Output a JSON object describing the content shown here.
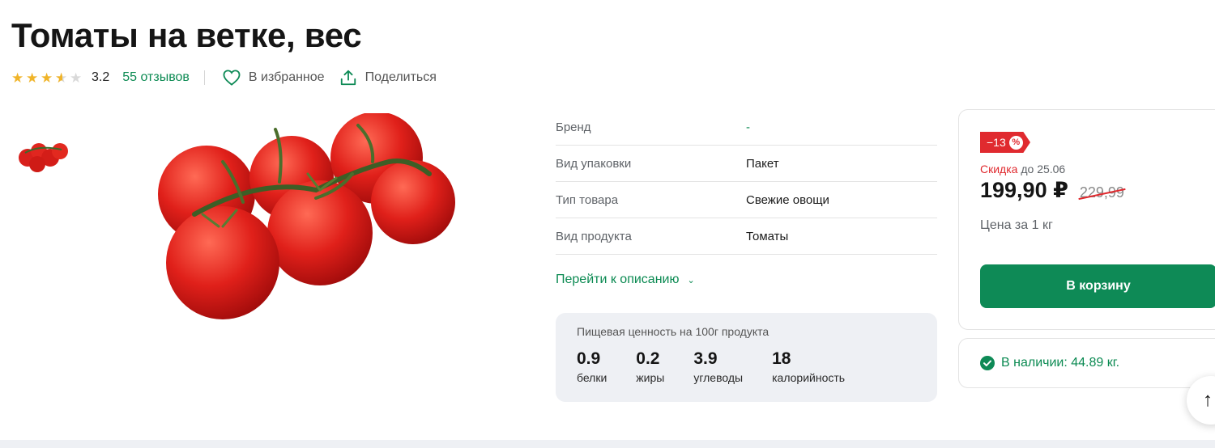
{
  "product": {
    "title": "Томаты на ветке, вес",
    "rating": 3.2,
    "rating_text": "3.2",
    "reviews_text": "55 отзывов",
    "favorite_label": "В избранное",
    "share_label": "Поделиться"
  },
  "properties": [
    {
      "key": "Бренд",
      "value": "-"
    },
    {
      "key": "Вид упаковки",
      "value": "Пакет"
    },
    {
      "key": "Тип товара",
      "value": "Свежие овощи"
    },
    {
      "key": "Вид продукта",
      "value": "Томаты"
    }
  ],
  "description_link": "Перейти к описанию",
  "nutrition": {
    "title": "Пищевая ценность на 100г продукта",
    "items": [
      {
        "value": "0.9",
        "label": "белки"
      },
      {
        "value": "0.2",
        "label": "жиры"
      },
      {
        "value": "3.9",
        "label": "углеводы"
      },
      {
        "value": "18",
        "label": "калорийность"
      }
    ]
  },
  "price": {
    "badge": "−13",
    "badge_icon": "%",
    "discount_word": "Скидка",
    "discount_until": "до 25.06",
    "current": "199,90 ₽",
    "old": "229,99",
    "unit": "Цена за 1 кг",
    "cart_button": "В корзину"
  },
  "stock": {
    "text": "В наличии: 44.89 кг."
  },
  "scroll_up_icon": "↑",
  "colors": {
    "accent_green": "#0e8a56",
    "discount_red": "#e02a2f",
    "star_yellow": "#f0b429"
  }
}
